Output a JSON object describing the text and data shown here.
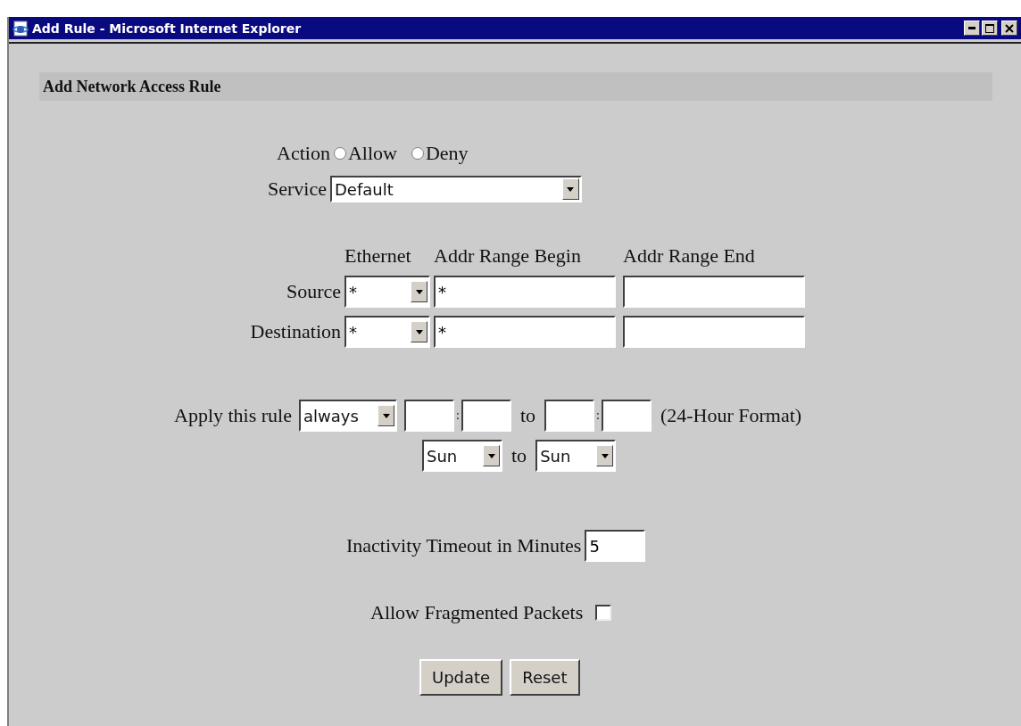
{
  "window": {
    "title": "Add Rule - Microsoft Internet Explorer"
  },
  "heading": "Add Network Access Rule",
  "action": {
    "label": "Action",
    "options": [
      {
        "label": "Allow",
        "selected": false
      },
      {
        "label": "Deny",
        "selected": false
      }
    ]
  },
  "service": {
    "label": "Service",
    "value": "Default"
  },
  "address_table": {
    "columns": [
      "Ethernet",
      "Addr Range Begin",
      "Addr Range End"
    ],
    "rows": [
      {
        "label": "Source",
        "ethernet": "*",
        "begin": "*",
        "end": ""
      },
      {
        "label": "Destination",
        "ethernet": "*",
        "begin": "*",
        "end": ""
      }
    ]
  },
  "schedule": {
    "label": "Apply this rule",
    "mode": "always",
    "from_separator": ":",
    "to": "to",
    "to_separator": ":",
    "format": "(24-Hour Format)",
    "day_from": "Sun",
    "day_to_label": "to",
    "day_to": "Sun"
  },
  "timeout": {
    "label": "Inactivity Timeout in Minutes",
    "value": "5"
  },
  "fragmented": {
    "label": "Allow Fragmented Packets",
    "checked": false
  },
  "buttons": [
    "Update",
    "Reset"
  ]
}
